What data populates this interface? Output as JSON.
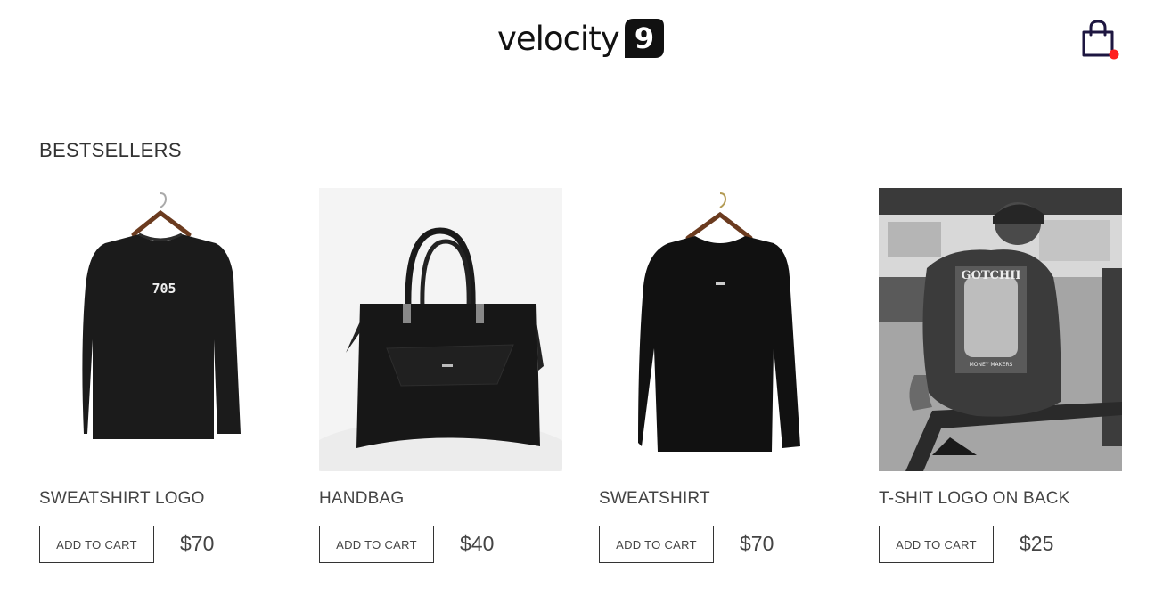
{
  "header": {
    "logo_text": "velocity",
    "logo_badge": "9",
    "cart_icon": "shopping-bag-icon",
    "cart_badge_color": "#ff1f1f"
  },
  "section": {
    "title": "BESTSELLERS"
  },
  "products": [
    {
      "name": "SWEATSHIRT LOGO",
      "button": "ADD TO CART",
      "price": "$70",
      "image": "sweatshirt-logo-image"
    },
    {
      "name": "HANDBAG",
      "button": "ADD TO CART",
      "price": "$40",
      "image": "handbag-image"
    },
    {
      "name": "SWEATSHIRT",
      "button": "ADD TO CART",
      "price": "$70",
      "image": "sweatshirt-image"
    },
    {
      "name": "T-SHIT LOGO ON BACK",
      "button": "ADD TO CART",
      "price": "$25",
      "image": "tshirt-back-image"
    }
  ],
  "colors": {
    "text": "#333333",
    "logo": "#111111",
    "cart_icon": "#1d1640"
  }
}
